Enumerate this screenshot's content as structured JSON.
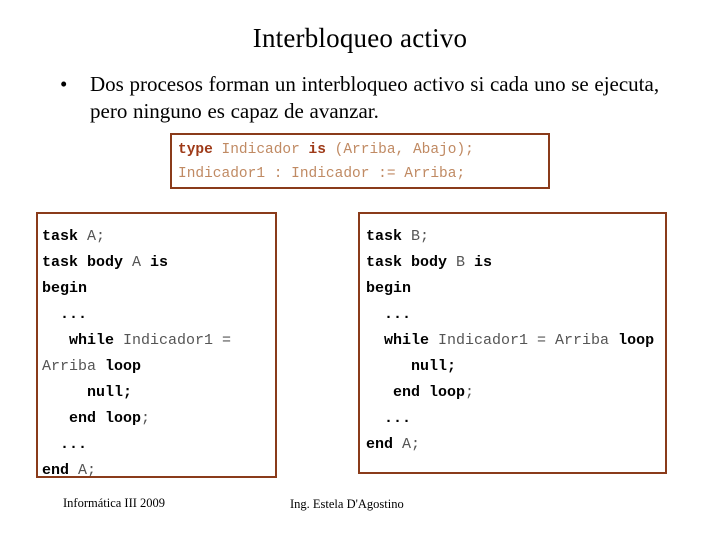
{
  "slide": {
    "title": "Interbloqueo activo",
    "bullet": {
      "marker": "•",
      "text": "Dos procesos forman un interbloqueo activo si cada uno se ejecuta, pero ninguno es capaz de avanzar."
    },
    "declaration_box": {
      "line1": {
        "kw1": "type",
        "mid1": " Indicador ",
        "kw2": "is",
        "mid2": " (Arriba, Abajo);"
      },
      "line2": "Indicador1 : Indicador := Arriba;"
    },
    "task_a": {
      "line1_kw": "task",
      "line1_id": " A;",
      "line2_kw": "task body",
      "line2_id": " A ",
      "line2_kw2": "is",
      "line3_kw": "begin",
      "line4": "...",
      "line5_kw": "while",
      "line5_id": " Indicador1 = Arriba ",
      "line5_kw2": "loop",
      "line6_kw": "null;",
      "line7_kw": "end loop",
      "line7_id": ";",
      "line8": "...",
      "line9_kw": "end",
      "line9_id": " A;"
    },
    "task_b": {
      "line1_kw": "task",
      "line1_id": " B;",
      "line2_kw": "task body",
      "line2_id": " B ",
      "line2_kw2": "is",
      "line3_kw": "begin",
      "line4": "...",
      "line5_kw": "while",
      "line5_id": " Indicador1 = Arriba ",
      "line5_kw2": "loop",
      "line6_kw": "null;",
      "line7_kw": "end loop",
      "line7_id": ";",
      "line8": "...",
      "line9_kw": "end",
      "line9_id": " A;"
    },
    "footer": {
      "left": "Informática III 2009",
      "right": "Ing. Estela D'Agostino"
    },
    "colors": {
      "box_border": "#8a3b1a",
      "decl_keyword": "#9e3a18",
      "decl_text": "#c08a63",
      "code_keyword": "#000000",
      "code_text": "#6f6f6f"
    }
  }
}
